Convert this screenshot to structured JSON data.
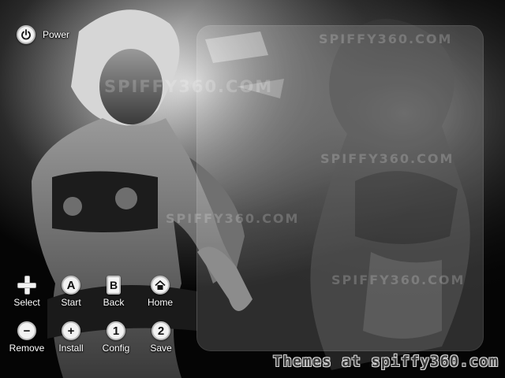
{
  "power": {
    "label": "Power",
    "icon": "power-icon"
  },
  "controls": {
    "select": {
      "label": "Select",
      "icon": "dpad-icon"
    },
    "start": {
      "label": "Start",
      "glyph": "A",
      "icon": "a-button-icon"
    },
    "back": {
      "label": "Back",
      "glyph": "B",
      "icon": "b-button-icon"
    },
    "home": {
      "label": "Home",
      "icon": "home-icon"
    },
    "remove": {
      "label": "Remove",
      "glyph": "−",
      "icon": "minus-button-icon"
    },
    "install": {
      "label": "Install",
      "glyph": "+",
      "icon": "plus-button-icon"
    },
    "config": {
      "label": "Config",
      "glyph": "1",
      "icon": "one-button-icon"
    },
    "save": {
      "label": "Save",
      "glyph": "2",
      "icon": "two-button-icon"
    }
  },
  "watermark": "SPIFFY360.COM",
  "footer": {
    "credit": "Themes at spiffy360.com"
  },
  "colors": {
    "background": "#0c0c0c",
    "button_fill": "#f2f2f2",
    "label_text": "#ffffff",
    "credit_text": "#3c3c3c"
  }
}
